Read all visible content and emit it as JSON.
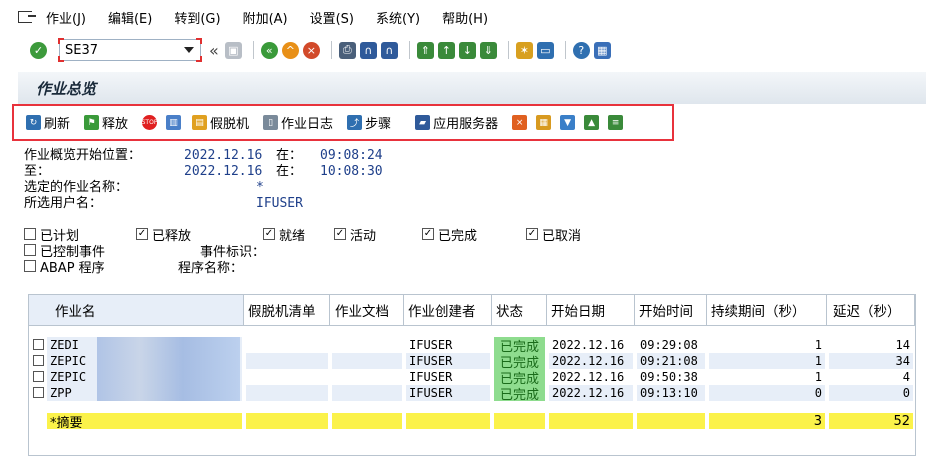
{
  "menu": [
    "作业(J)",
    "编辑(E)",
    "转到(G)",
    "附加(A)",
    "设置(S)",
    "系统(Y)",
    "帮助(H)"
  ],
  "command_field": {
    "value": "SE37"
  },
  "panel": {
    "title": "作业总览"
  },
  "app_toolbar": {
    "refresh": "刷新",
    "release": "释放",
    "spool": "假脱机",
    "job_log": "作业日志",
    "step": "步骤",
    "app_server": "应用服务器"
  },
  "info": {
    "start_label": "作业概览开始位置：",
    "start_date": "2022.12.16",
    "at1": "在：",
    "start_time": "09:08:24",
    "to_label": "至：",
    "end_date": "2022.12.16",
    "at2": "在：",
    "end_time": "10:08:30",
    "jobname_label": "选定的作业名称：",
    "jobname_value": "*",
    "user_label": "所选用户名：",
    "user_value": "IFUSER"
  },
  "checks": {
    "planned": {
      "label": "已计划",
      "checked": false
    },
    "released": {
      "label": "已释放",
      "checked": true
    },
    "ready": {
      "label": "就绪",
      "checked": true
    },
    "active": {
      "label": "活动",
      "checked": true
    },
    "finished": {
      "label": "已完成",
      "checked": true
    },
    "cancelled": {
      "label": "已取消",
      "checked": true
    },
    "event_controlled": {
      "label": "已控制事件",
      "checked": false
    },
    "event_id_label": "事件标识：",
    "abap": {
      "label": "ABAP 程序",
      "checked": false
    },
    "program_name_label": "程序名称："
  },
  "table": {
    "headers": [
      "作业名",
      "假脱机清单",
      "作业文档",
      "作业创建者",
      "状态",
      "开始日期",
      "开始时间",
      "持续期间（秒）",
      "延迟（秒）"
    ],
    "rows": [
      {
        "name": "ZEDI",
        "creator": "IFUSER",
        "status": "已完成",
        "date": "2022.12.16",
        "time": "09:29:08",
        "duration": "1",
        "delay": "14"
      },
      {
        "name": "ZEPIC",
        "creator": "IFUSER",
        "status": "已完成",
        "date": "2022.12.16",
        "time": "09:21:08",
        "duration": "1",
        "delay": "34"
      },
      {
        "name": "ZEPIC",
        "creator": "IFUSER",
        "status": "已完成",
        "date": "2022.12.16",
        "time": "09:50:38",
        "duration": "1",
        "delay": "4"
      },
      {
        "name": "ZPP",
        "creator": "IFUSER",
        "status": "已完成",
        "date": "2022.12.16",
        "time": "09:13:10",
        "duration": "0",
        "delay": "0"
      }
    ],
    "summary": {
      "label": "*摘要",
      "duration": "3",
      "delay": "52"
    }
  }
}
